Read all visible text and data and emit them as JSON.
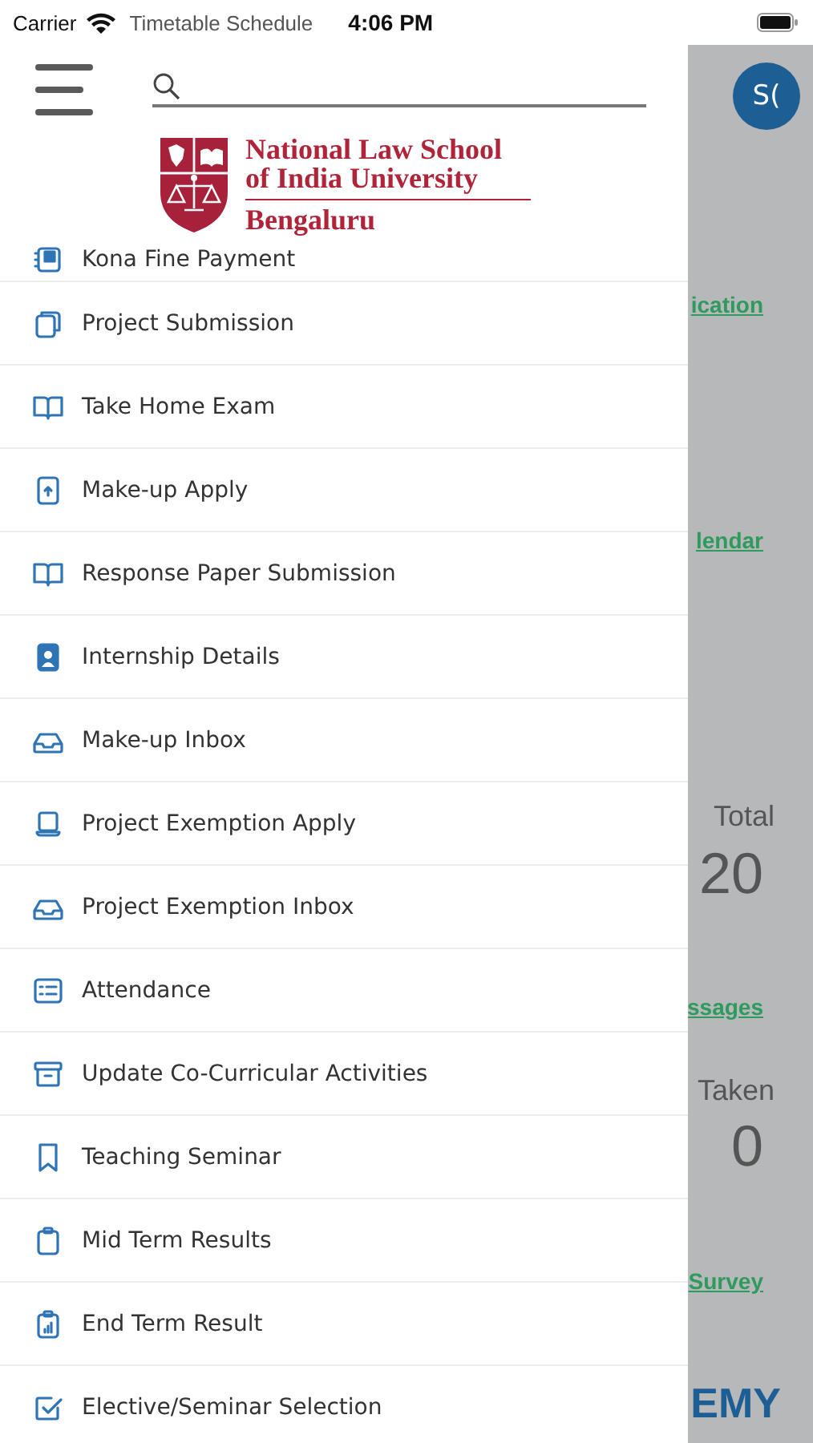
{
  "status_bar": {
    "carrier": "Carrier",
    "time": "4:06 PM"
  },
  "page_title": "Timetable Schedule",
  "logo": {
    "lines": [
      "National Law School",
      "of India University"
    ],
    "city": "Bengaluru"
  },
  "menu_items": [
    {
      "label": "Kona Fine Payment",
      "kind": "receipt"
    },
    {
      "label": "Project Submission",
      "kind": "copy"
    },
    {
      "label": "Take Home Exam",
      "kind": "book"
    },
    {
      "label": "Make-up Apply",
      "kind": "upload"
    },
    {
      "label": "Response Paper Submission",
      "kind": "book"
    },
    {
      "label": "Internship Details",
      "kind": "badge"
    },
    {
      "label": "Make-up Inbox",
      "kind": "inbox"
    },
    {
      "label": "Project Exemption Apply",
      "kind": "laptop"
    },
    {
      "label": "Project Exemption Inbox",
      "kind": "inbox"
    },
    {
      "label": "Attendance",
      "kind": "list"
    },
    {
      "label": "Update Co-Curricular Activities",
      "kind": "archive"
    },
    {
      "label": "Teaching Seminar",
      "kind": "bookmark"
    },
    {
      "label": "Mid Term Results",
      "kind": "clipboard"
    },
    {
      "label": "End Term Result",
      "kind": "chart"
    },
    {
      "label": "Elective/Seminar Selection",
      "kind": "check"
    }
  ],
  "background": {
    "avatar": "S(",
    "items": [
      {
        "kind": "link",
        "text": "ication"
      },
      {
        "kind": "link",
        "text": "lendar"
      },
      {
        "kind": "label",
        "text": "Total"
      },
      {
        "kind": "number",
        "text": "20"
      },
      {
        "kind": "link",
        "text": "ssages"
      },
      {
        "kind": "label",
        "text": "Taken"
      },
      {
        "kind": "number",
        "text": "0"
      },
      {
        "kind": "link",
        "text": "Survey"
      },
      {
        "kind": "brand",
        "text": "EMY"
      }
    ]
  }
}
